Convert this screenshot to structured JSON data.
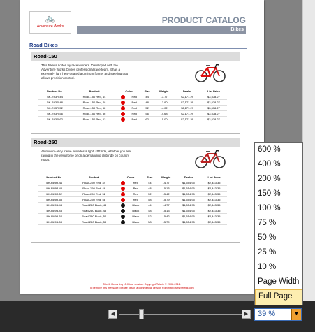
{
  "catalog": {
    "title": "PRODUCT CATALOG",
    "subtitle": "Bikes",
    "logo_text": "Adventure Works",
    "section": "Road Bikes"
  },
  "products": [
    {
      "name": "Road-150",
      "description": "This bike is ridden by race winners. Developed with the Adventure Works Cycles professional race team, it has a extremely light heat-treated aluminum frame, and steering that allows precision control.",
      "headers": [
        "Product No.",
        "Product",
        "Color",
        "Size",
        "Weight",
        "Dealer",
        "List Price"
      ],
      "rows": [
        [
          "BK-R93R-44",
          "Road-150 Red, 44",
          "Red",
          "44",
          "13.77",
          "$2,171.29",
          "$3,578.27"
        ],
        [
          "BK-R93R-48",
          "Road-150 Red, 48",
          "Red",
          "48",
          "13.90",
          "$2,171.29",
          "$3,578.27"
        ],
        [
          "BK-R93R-52",
          "Road-150 Red, 52",
          "Red",
          "52",
          "14.02",
          "$2,171.29",
          "$3,578.27"
        ],
        [
          "BK-R93R-56",
          "Road-150 Red, 56",
          "Red",
          "56",
          "14.68",
          "$2,171.29",
          "$3,578.27"
        ],
        [
          "BK-R93R-62",
          "Road-150 Red, 62",
          "Red",
          "62",
          "15.00",
          "$2,171.29",
          "$3,578.27"
        ]
      ]
    },
    {
      "name": "Road-250",
      "description": "Aluminum-alloy frame provides a light, stiff ride, whether you are racing in the velodrome or on a demanding club ride on country roads.",
      "headers": [
        "Product No.",
        "Product",
        "Color",
        "Size",
        "Weight",
        "Dealer",
        "List Price"
      ],
      "rows": [
        [
          "BK-R89R-44",
          "Road-250 Red, 44",
          "Red",
          "44",
          "14.77",
          "$1,554.95",
          "$2,443.35"
        ],
        [
          "BK-R89R-48",
          "Road-250 Red, 48",
          "Red",
          "48",
          "15.13",
          "$1,554.95",
          "$2,443.35"
        ],
        [
          "BK-R89R-52",
          "Road-250 Red, 52",
          "Red",
          "52",
          "15.42",
          "$1,554.95",
          "$2,443.35"
        ],
        [
          "BK-R89R-58",
          "Road-250 Red, 58",
          "Red",
          "58",
          "15.79",
          "$1,554.95",
          "$2,443.35"
        ],
        [
          "BK-R89B-44",
          "Road-250 Black, 44",
          "Black",
          "44",
          "14.77",
          "$1,554.95",
          "$2,443.35"
        ],
        [
          "BK-R89B-48",
          "Road-250 Black, 48",
          "Black",
          "48",
          "15.13",
          "$1,554.95",
          "$2,443.35"
        ],
        [
          "BK-R89B-52",
          "Road-250 Black, 52",
          "Black",
          "52",
          "15.42",
          "$1,554.95",
          "$2,443.35"
        ],
        [
          "BK-R89B-58",
          "Road-250 Black, 58",
          "Black",
          "58",
          "15.79",
          "$1,554.95",
          "$2,443.35"
        ]
      ]
    }
  ],
  "footer": {
    "line1": "Telerik Reporting v5.0 trial version. Copyright Telerik © 2002-2011.",
    "line2": "To remove this message, please obtain a commercial version from http://www.telerik.com"
  },
  "zoom": {
    "current": "39 %",
    "options": [
      "600 %",
      "400 %",
      "200 %",
      "150 %",
      "100 %",
      "75 %",
      "50 %",
      "25 %",
      "10 %",
      "Page Width",
      "Full Page"
    ],
    "highlighted": "Full Page"
  },
  "colors": {
    "Red": "#e00000",
    "Black": "#111111",
    "dropdown_arrow": "#f0a030",
    "selected_option": "#fdeeb0"
  },
  "icons": {
    "slider_left": "triangle-left",
    "slider_right": "triangle-right",
    "dropdown": "triangle-down"
  }
}
